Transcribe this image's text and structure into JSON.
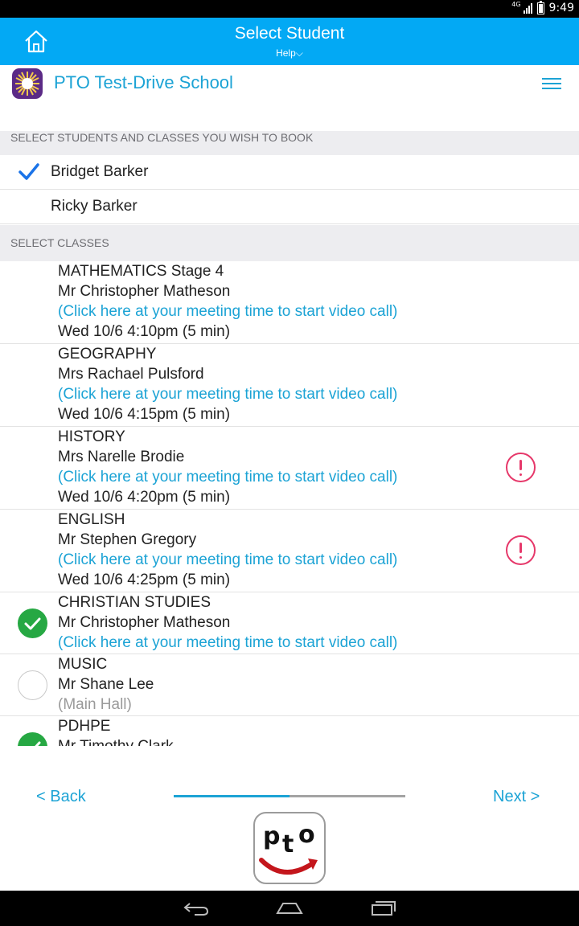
{
  "status_bar": {
    "network": "4G",
    "time": "9:49"
  },
  "header": {
    "title": "Select Student",
    "help_label": "Help",
    "help_chevron": "⌵",
    "home_icon": "home-icon"
  },
  "school": {
    "name": "PTO Test-Drive School",
    "menu_icon": "hamburger-icon"
  },
  "students_section": {
    "heading": "SELECT STUDENTS AND CLASSES YOU WISH TO BOOK",
    "students": [
      {
        "name": "Bridget Barker",
        "selected": true
      },
      {
        "name": "Ricky Barker",
        "selected": false
      }
    ]
  },
  "classes_section": {
    "heading": "SELECT CLASSES",
    "classes": [
      {
        "subject": "MATHEMATICS Stage 4",
        "teacher": "Mr Christopher Matheson",
        "location": "(Click here at your meeting time to start video call)",
        "time": "Wed 10/6 4:10pm (5 min)",
        "state": "booked",
        "alert": false
      },
      {
        "subject": "GEOGRAPHY",
        "teacher": "Mrs Rachael Pulsford",
        "location": "(Click here at your meeting time to start video call)",
        "time": "Wed 10/6 4:15pm (5 min)",
        "state": "booked",
        "alert": false
      },
      {
        "subject": "HISTORY",
        "teacher": "Mrs Narelle Brodie",
        "location": "(Click here at your meeting time to start video call)",
        "time": "Wed 10/6 4:20pm (5 min)",
        "state": "booked",
        "alert": true
      },
      {
        "subject": "ENGLISH",
        "teacher": "Mr Stephen Gregory",
        "location": "(Click here at your meeting time to start video call)",
        "time": "Wed 10/6 4:25pm (5 min)",
        "state": "booked",
        "alert": true
      },
      {
        "subject": "CHRISTIAN STUDIES",
        "teacher": "Mr Christopher Matheson",
        "location": "(Click here at your meeting time to start video call)",
        "state": "checked"
      },
      {
        "subject": "MUSIC",
        "teacher": "Mr Shane Lee",
        "location": "(Main Hall)",
        "state": "unchecked"
      },
      {
        "subject": "PDHPE",
        "teacher": "Mr Timothy Clark",
        "state": "checked"
      }
    ]
  },
  "footer": {
    "back_label": "< Back",
    "next_label": "Next >",
    "progress": 0.5,
    "logo_text": "pto"
  },
  "colors": {
    "accent": "#03a9f4",
    "link": "#1ca3d5",
    "alert": "#e6386a",
    "success": "#26a843"
  }
}
